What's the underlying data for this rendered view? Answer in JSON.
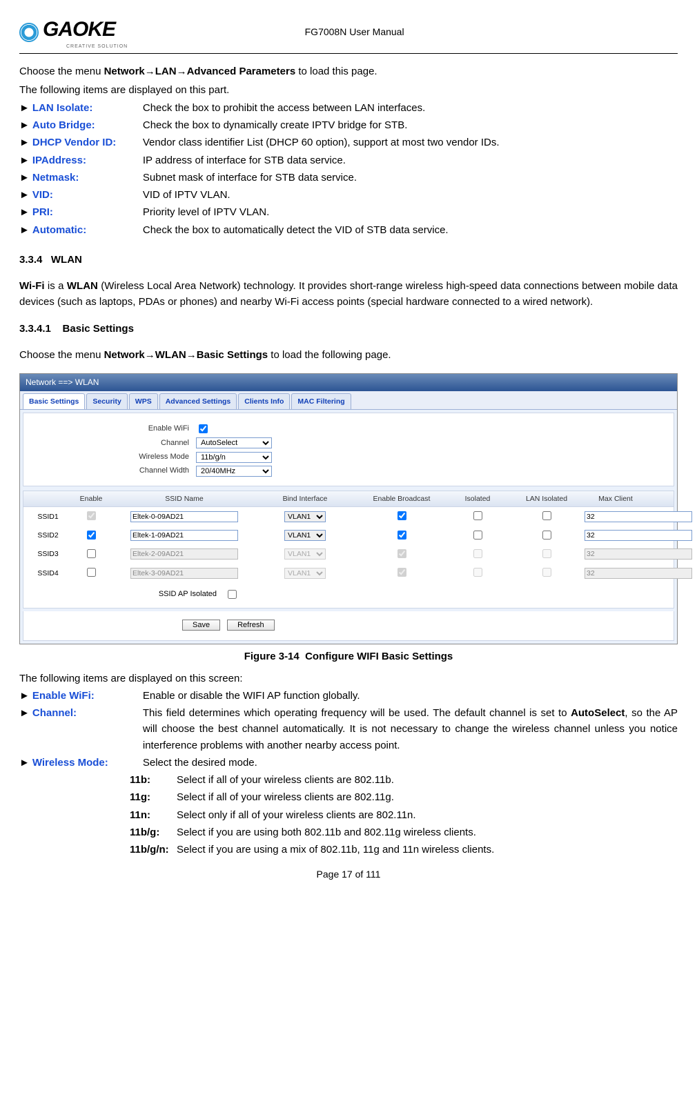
{
  "header": {
    "logo_text": "GAOKE",
    "logo_sub": "CREATIVE SOLUTION",
    "doc_title": "FG7008N User Manual"
  },
  "intro": {
    "line1_pre": "Choose the menu ",
    "line1_path": "Network→LAN→Advanced Parameters",
    "line1_post": " to load this page.",
    "line2": "The following items are displayed on this part."
  },
  "params": [
    {
      "label": "LAN Isolate:",
      "desc": "Check the box to prohibit the access between LAN interfaces."
    },
    {
      "label": "Auto Bridge:",
      "desc": "Check the box to dynamically create IPTV bridge for STB."
    },
    {
      "label": "DHCP Vendor ID:",
      "desc": "Vendor class identifier List (DHCP 60 option), support at most two vendor IDs."
    },
    {
      "label": "IPAddress:",
      "desc": "IP address of interface for STB data service."
    },
    {
      "label": "Netmask:",
      "desc": "Subnet mask of interface for STB data service."
    },
    {
      "label": "VID:",
      "desc": "VID of IPTV VLAN."
    },
    {
      "label": "PRI:",
      "desc": "Priority level of IPTV VLAN."
    },
    {
      "label": "Automatic:",
      "desc": "Check the box to automatically detect the VID of STB data service."
    }
  ],
  "section": {
    "num": "3.3.4",
    "title": "WLAN",
    "wifi_para_pre": "Wi-Fi",
    "wifi_para_mid": " is a ",
    "wifi_para_bold": "WLAN",
    "wifi_para_rest": " (Wireless Local Area Network) technology. It provides short-range wireless high-speed data connections between mobile data devices (such as laptops, PDAs or phones) and nearby Wi-Fi access points (special hardware connected to a wired network)."
  },
  "subsection": {
    "num": "3.3.4.1",
    "title": "Basic Settings",
    "lead_pre": "Choose the menu ",
    "lead_path": "Network→WLAN→Basic Settings",
    "lead_post": " to load the following page."
  },
  "app": {
    "titlebar": "Network ==> WLAN",
    "tabs": [
      "Basic Settings",
      "Security",
      "WPS",
      "Advanced Settings",
      "Clients Info",
      "MAC Filtering"
    ],
    "form": {
      "enable_wifi": "Enable WiFi",
      "channel_label": "Channel",
      "channel_value": "AutoSelect",
      "mode_label": "Wireless Mode",
      "mode_value": "11b/g/n",
      "width_label": "Channel Width",
      "width_value": "20/40MHz"
    },
    "grid": {
      "headers": [
        "",
        "Enable",
        "SSID Name",
        "Bind Interface",
        "Enable Broadcast",
        "Isolated",
        "LAN Isolated",
        "Max Client"
      ],
      "rows": [
        {
          "id": "SSID1",
          "enable": true,
          "enable_locked": true,
          "ssid": "Eltek-0-09AD21",
          "bind": "VLAN1",
          "broadcast": true,
          "isolated": false,
          "lan_isolated": false,
          "max": "32",
          "disabled": false
        },
        {
          "id": "SSID2",
          "enable": true,
          "enable_locked": false,
          "ssid": "Eltek-1-09AD21",
          "bind": "VLAN1",
          "broadcast": true,
          "isolated": false,
          "lan_isolated": false,
          "max": "32",
          "disabled": false
        },
        {
          "id": "SSID3",
          "enable": false,
          "enable_locked": false,
          "ssid": "Eltek-2-09AD21",
          "bind": "VLAN1",
          "broadcast": true,
          "isolated": false,
          "lan_isolated": false,
          "max": "32",
          "disabled": true
        },
        {
          "id": "SSID4",
          "enable": false,
          "enable_locked": false,
          "ssid": "Eltek-3-09AD21",
          "bind": "VLAN1",
          "broadcast": true,
          "isolated": false,
          "lan_isolated": false,
          "max": "32",
          "disabled": true
        }
      ],
      "ap_isolated_label": "SSID AP Isolated"
    },
    "buttons": {
      "save": "Save",
      "refresh": "Refresh"
    }
  },
  "figure": {
    "num": "Figure 3-14",
    "title": "Configure WIFI Basic Settings"
  },
  "post": {
    "lead": "The following items are displayed on this screen:",
    "items": [
      {
        "label": "Enable WiFi:",
        "desc": "Enable or disable the WIFI AP function globally."
      },
      {
        "label": "Channel:",
        "desc_pre": "This field determines which operating frequency will be used. The default channel is set to ",
        "desc_bold": "AutoSelect",
        "desc_post": ", so the AP will choose the best channel automatically. It is not necessary to change the wireless channel unless you notice interference problems with another nearby access point."
      },
      {
        "label": "Wireless Mode:",
        "desc": "Select the desired mode."
      }
    ],
    "modes": [
      {
        "key": "11b:",
        "desc": "Select if all of your wireless clients are 802.11b."
      },
      {
        "key": "11g:",
        "desc": "Select if all of your wireless clients are 802.11g."
      },
      {
        "key": "11n:",
        "desc": "Select only if all of your wireless clients are 802.11n."
      },
      {
        "key": "11b/g:",
        "desc": "Select if you are using both 802.11b and 802.11g wireless clients."
      },
      {
        "key": "11b/g/n:",
        "desc": "Select if you are using a mix of 802.11b, 11g and 11n wireless clients."
      }
    ]
  },
  "footer": {
    "page": "Page 17 of 111"
  }
}
